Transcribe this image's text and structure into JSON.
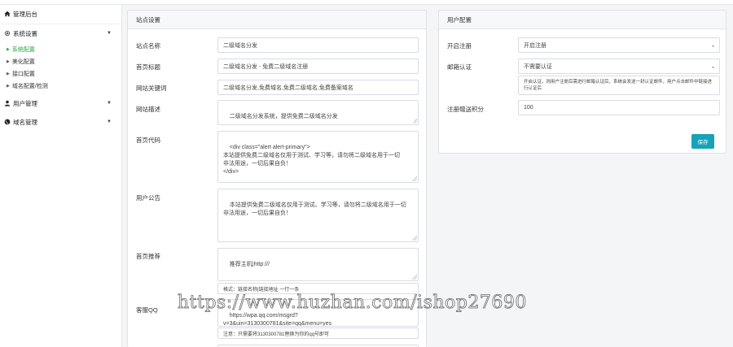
{
  "sidebar": {
    "brand": "管理后台",
    "menu": [
      {
        "label": "系统设置",
        "sub": [
          "系统配置",
          "美化配置",
          "接口配置",
          "域名配置/检测"
        ],
        "active_sub": 0
      },
      {
        "label": "用户管理"
      },
      {
        "label": "域名管理"
      }
    ]
  },
  "site_settings": {
    "title": "站点设置",
    "fields": {
      "site_name": {
        "label": "站点名称",
        "value": "二级域名分发"
      },
      "home_title": {
        "label": "首页标题",
        "value": "二级域名分发 - 免费二级域名注册"
      },
      "keywords": {
        "label": "网站关键词",
        "value": "二级域名分发,免费域名,免费二级域名,免费备案域名"
      },
      "description": {
        "label": "网站描述",
        "value": "二级域名分发系统，提供免费二级域名分发"
      },
      "home_code": {
        "label": "首页代码",
        "value": "<div class=\"alert alert-primary\">\n本站提供免费二级域名仅用于测试、学习等，请勿将二级域名用于一切\n非法用途，一切后果自负！\n</div>"
      },
      "notice": {
        "label": "用户公告",
        "value": "本站提供免费二级域名仅用于测试、学习等，请勿将二级域名用于一切\n非法用途，一切后果自负！"
      },
      "home_recommend": {
        "label": "首页推荐",
        "value": "推荐主机|http:///",
        "help": "格式：链接名称|链接地址 一行一条"
      },
      "service_qq": {
        "label": "客服QQ",
        "value": "https://wpa.qq.com/msgrd?\nv=3&uin=3130300781&site=qq&menu=yes",
        "help": "注意：只需要将3130300781替换为你的qq号即可"
      }
    }
  },
  "user_config": {
    "title": "用户配置",
    "fields": {
      "register": {
        "label": "开启注册",
        "value": "开启注册"
      },
      "email_verify": {
        "label": "邮箱认证",
        "value": "不需要认证",
        "help": "开启认证，则用户注册后需进行邮箱认证后，系统会发送一封认证邮件，用户点击邮件中链接进行认证后"
      },
      "register_points": {
        "label": "注册赠送积分",
        "value": "100"
      }
    },
    "save_label": "保存"
  },
  "watermark": "https://www.huzhan.com/ishop27690"
}
